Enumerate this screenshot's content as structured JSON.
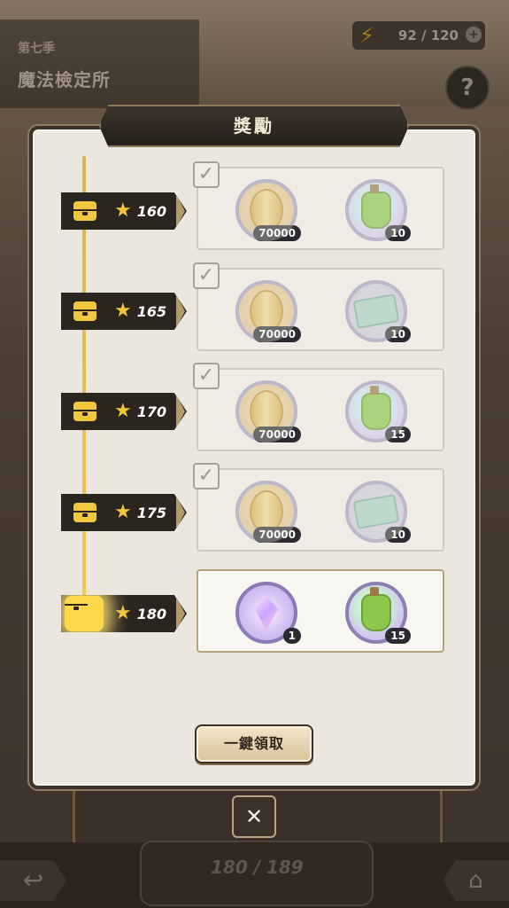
{
  "background": {
    "season": "第七季",
    "location": "魔法檢定所",
    "energy": "92 / 120",
    "help_icon": "?",
    "progress": "180 / 189"
  },
  "modal": {
    "title": "獎勵",
    "tiers": [
      {
        "stars": "160",
        "claimed": true,
        "rewards": [
          {
            "type": "coin",
            "count": "70000"
          },
          {
            "type": "potion",
            "count": "10"
          }
        ]
      },
      {
        "stars": "165",
        "claimed": true,
        "rewards": [
          {
            "type": "coin",
            "count": "70000"
          },
          {
            "type": "ticket",
            "count": "10"
          }
        ]
      },
      {
        "stars": "170",
        "claimed": true,
        "rewards": [
          {
            "type": "coin",
            "count": "70000"
          },
          {
            "type": "potion",
            "count": "15"
          }
        ]
      },
      {
        "stars": "175",
        "claimed": true,
        "rewards": [
          {
            "type": "coin",
            "count": "70000"
          },
          {
            "type": "ticket",
            "count": "10"
          }
        ]
      },
      {
        "stars": "180",
        "claimed": false,
        "rewards": [
          {
            "type": "crystal",
            "count": "1"
          },
          {
            "type": "potion",
            "count": "15"
          }
        ]
      }
    ],
    "claim_all_label": "一鍵領取",
    "close_label": "✕"
  },
  "icons": {
    "check": "✓",
    "star": "★",
    "back": "↩",
    "home": "⌂",
    "bolt": "⚡",
    "plus": "+"
  }
}
